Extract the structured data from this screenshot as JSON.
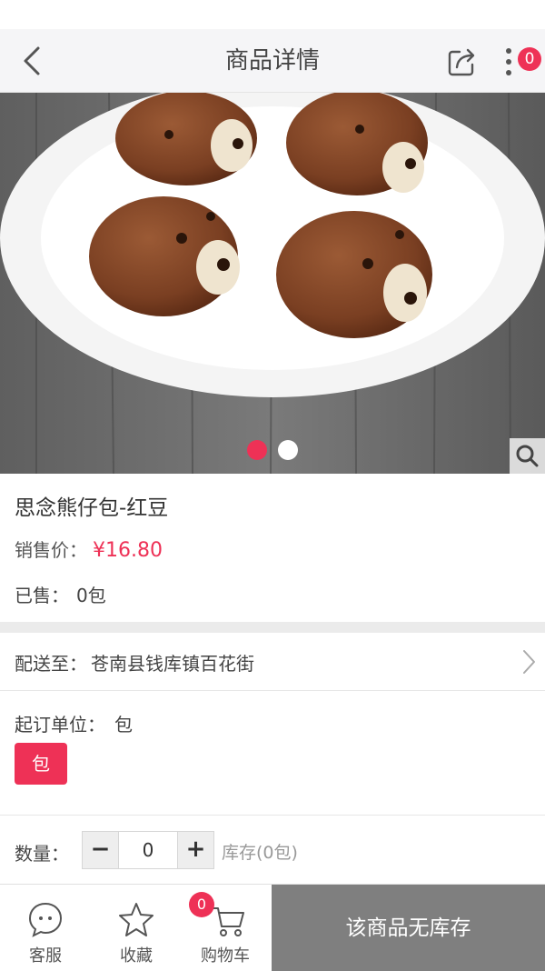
{
  "header": {
    "title": "商品详情",
    "cart_badge": "0",
    "back_icon": "chevron-left-icon",
    "share_icon": "share-icon",
    "more_icon": "more-vertical-icon"
  },
  "gallery": {
    "slide_count": 2,
    "active_index": 0,
    "image": "chocolate bear buns on white plate",
    "zoom_icon": "search-icon"
  },
  "product": {
    "name": "思念熊仔包-红豆",
    "price_label": "销售价：",
    "price": "¥16.80",
    "sold_label": "已售：",
    "sold_value": "0包"
  },
  "delivery": {
    "label": "配送至：",
    "address": "苍南县钱库镇百花街"
  },
  "unit": {
    "label": "起订单位：",
    "value": "包",
    "option": "包"
  },
  "quantity": {
    "label": "数量：",
    "value": "0",
    "minus": "−",
    "plus": "+",
    "stock": "库存(0包)"
  },
  "bottom_bar": {
    "service_label": "客服",
    "favorite_label": "收藏",
    "cart_label": "购物车",
    "cart_badge": "0",
    "action_label": "该商品无库存"
  },
  "colors": {
    "accent": "#ee3156",
    "disabled": "#7f7f7f"
  }
}
